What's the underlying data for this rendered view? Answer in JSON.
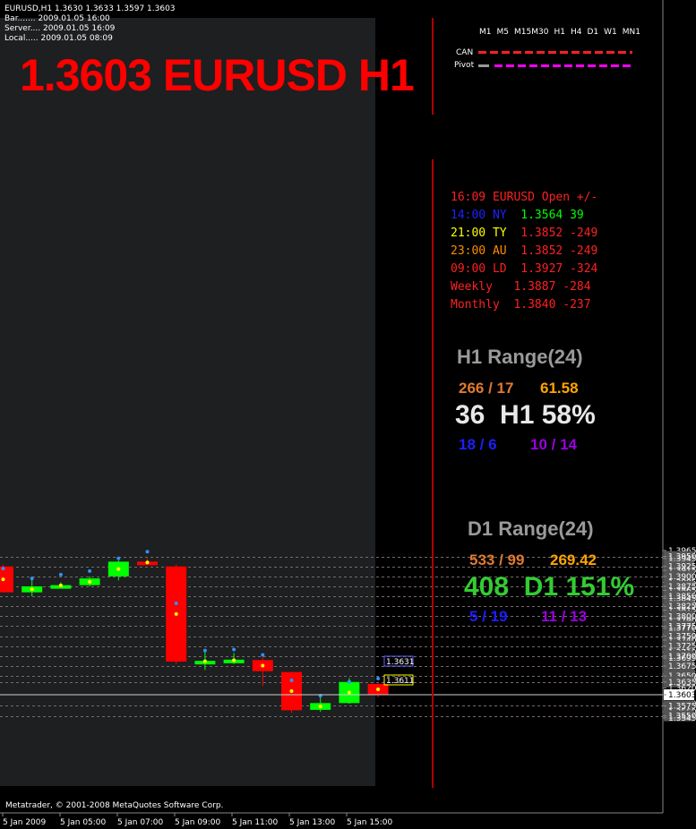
{
  "header": {
    "symbol_line": "EURUSD,H1  1.3630 1.3633 1.3597 1.3603",
    "bar_time": "Bar....... 2009.01.05 16:00",
    "server_time": "Server.... 2009.01.05 16:09",
    "local_time": "Local..... 2009.01.05 08:09"
  },
  "big_price_title": "1.3603 EURUSD H1",
  "timeframes": [
    "M1",
    "M5",
    "M15",
    "M30",
    "H1",
    "H4",
    "D1",
    "W1",
    "MN1"
  ],
  "legend": [
    {
      "label": "CAN",
      "color": "#ff2020"
    },
    {
      "label": "Pivot",
      "color": "#ff00ff"
    }
  ],
  "session_table": {
    "header": "16:09 EURUSD Open +/-",
    "rows": [
      {
        "time": "14:00",
        "market": "NY",
        "price": "1.3564",
        "diff": "39",
        "label_color": "#2020ff",
        "value_color": "#00ff00"
      },
      {
        "time": "21:00",
        "market": "TY",
        "price": "1.3852",
        "diff": "-249",
        "label_color": "#ffff00",
        "value_color": "#ff2020"
      },
      {
        "time": "23:00",
        "market": "AU",
        "price": "1.3852",
        "diff": "-249",
        "label_color": "#ff8c00",
        "value_color": "#ff2020"
      },
      {
        "time": "09:00",
        "market": "LD",
        "price": "1.3927",
        "diff": "-324",
        "label_color": "#ff2020",
        "value_color": "#ff2020"
      },
      {
        "time": "Weekly",
        "market": "",
        "price": "1.3887",
        "diff": "-284",
        "label_color": "#ff2020",
        "value_color": "#ff2020"
      },
      {
        "time": "Monthly",
        "market": "",
        "price": "1.3840",
        "diff": "-237",
        "label_color": "#ff2020",
        "value_color": "#ff2020"
      }
    ]
  },
  "h1_range": {
    "title": "H1 Range(24)",
    "ratio": "266 / 17",
    "avg": "61.58",
    "pips": "36",
    "tf": "H1",
    "percent": "58%",
    "up": "18 / 6",
    "down": "10 / 14"
  },
  "d1_range": {
    "title": "D1 Range(24)",
    "ratio": "533 / 99",
    "avg": "269.42",
    "pips": "408",
    "tf": "D1",
    "percent": "151%",
    "up": "5 / 19",
    "down": "11 / 13"
  },
  "footer": "Metatrader, © 2001-2008 MetaQuotes Software Corp.",
  "chart_data": {
    "type": "candlestick",
    "price_axis": [
      "1.3965",
      "1.3950",
      "1.3945",
      "1.3925",
      "1.3915",
      "1.3900",
      "1.3885",
      "1.3875",
      "1.3865",
      "1.3850",
      "1.3845",
      "1.3830",
      "1.3825",
      "1.3815",
      "1.3800",
      "1.3790",
      "1.3775",
      "1.3770",
      "1.3755",
      "1.3750",
      "1.3740",
      "1.3725",
      "1.3710",
      "1.3700",
      "1.3695",
      "1.3675",
      "1.3655",
      "1.3650",
      "1.3640",
      "1.3635",
      "1.3620",
      "1.3603",
      "1.3580",
      "1.3575",
      "1.3560",
      "1.3550",
      "1.3545"
    ],
    "highlighted_levels": [
      "1.3950",
      "1.3925",
      "1.3900",
      "1.3875",
      "1.3850",
      "1.3825",
      "1.3800",
      "1.3775",
      "1.3750",
      "1.3725",
      "1.3700",
      "1.3675",
      "1.3650",
      "1.3635",
      "1.3603",
      "1.3575",
      "1.3550"
    ],
    "time_axis": [
      "5 Jan 2009",
      "5 Jan 05:00",
      "5 Jan 07:00",
      "5 Jan 09:00",
      "5 Jan 11:00",
      "5 Jan 13:00",
      "5 Jan 15:00"
    ],
    "price_tags": [
      "1.3631",
      "1.3611"
    ],
    "current_price": "1.3603",
    "candles": [
      {
        "o": 1.3925,
        "h": 1.393,
        "l": 1.386,
        "c": 1.386,
        "dir": "down"
      },
      {
        "o": 1.386,
        "h": 1.39,
        "l": 1.385,
        "c": 1.3875,
        "dir": "up"
      },
      {
        "o": 1.3877,
        "h": 1.3885,
        "l": 1.387,
        "c": 1.3878,
        "dir": "up"
      },
      {
        "o": 1.3878,
        "h": 1.39,
        "l": 1.3875,
        "c": 1.3895,
        "dir": "up"
      },
      {
        "o": 1.39,
        "h": 1.394,
        "l": 1.389,
        "c": 1.3937,
        "dir": "up"
      },
      {
        "o": 1.3937,
        "h": 1.3945,
        "l": 1.393,
        "c": 1.3933,
        "dir": "down"
      },
      {
        "o": 1.3925,
        "h": 1.393,
        "l": 1.368,
        "c": 1.3686,
        "dir": "down"
      },
      {
        "o": 1.3686,
        "h": 1.3712,
        "l": 1.3665,
        "c": 1.3688,
        "dir": "up"
      },
      {
        "o": 1.3688,
        "h": 1.3708,
        "l": 1.368,
        "c": 1.3691,
        "dir": "up"
      },
      {
        "o": 1.369,
        "h": 1.3697,
        "l": 1.3625,
        "c": 1.3662,
        "dir": "down"
      },
      {
        "o": 1.366,
        "h": 1.366,
        "l": 1.3557,
        "c": 1.3564,
        "dir": "down"
      },
      {
        "o": 1.3565,
        "h": 1.36,
        "l": 1.356,
        "c": 1.3582,
        "dir": "up"
      },
      {
        "o": 1.3582,
        "h": 1.3645,
        "l": 1.358,
        "c": 1.3635,
        "dir": "up"
      },
      {
        "o": 1.363,
        "h": 1.3633,
        "l": 1.3597,
        "c": 1.3603,
        "dir": "down"
      }
    ]
  }
}
